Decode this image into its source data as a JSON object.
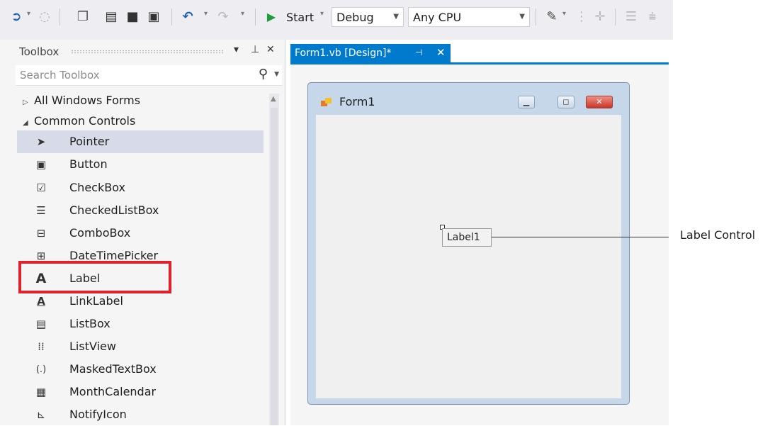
{
  "toolbar": {
    "start_label": "Start",
    "config_value": "Debug",
    "platform_value": "Any CPU"
  },
  "toolbox": {
    "title": "Toolbox",
    "search_placeholder": "Search Toolbox",
    "groups": [
      {
        "label": "All Windows Forms",
        "expanded": false
      },
      {
        "label": "Common Controls",
        "expanded": true
      }
    ],
    "items": [
      {
        "label": "Pointer",
        "icon": "pointer-icon",
        "selected": true
      },
      {
        "label": "Button",
        "icon": "button-icon"
      },
      {
        "label": "CheckBox",
        "icon": "checkbox-icon"
      },
      {
        "label": "CheckedListBox",
        "icon": "checkedlistbox-icon"
      },
      {
        "label": "ComboBox",
        "icon": "combobox-icon"
      },
      {
        "label": "DateTimePicker",
        "icon": "datetimepicker-icon"
      },
      {
        "label": "Label",
        "icon": "label-icon",
        "highlighted": true
      },
      {
        "label": "LinkLabel",
        "icon": "linklabel-icon"
      },
      {
        "label": "ListBox",
        "icon": "listbox-icon"
      },
      {
        "label": "ListView",
        "icon": "listview-icon"
      },
      {
        "label": "MaskedTextBox",
        "icon": "maskedtextbox-icon"
      },
      {
        "label": "MonthCalendar",
        "icon": "monthcalendar-icon"
      },
      {
        "label": "NotifyIcon",
        "icon": "notifyicon-icon"
      }
    ],
    "highlight_color": "#e0202a"
  },
  "tab": {
    "label": "Form1.vb [Design]*",
    "accent": "#007acc"
  },
  "form": {
    "title": "Form1",
    "label_control_text": "Label1"
  },
  "callout": {
    "text": "Label Control"
  }
}
